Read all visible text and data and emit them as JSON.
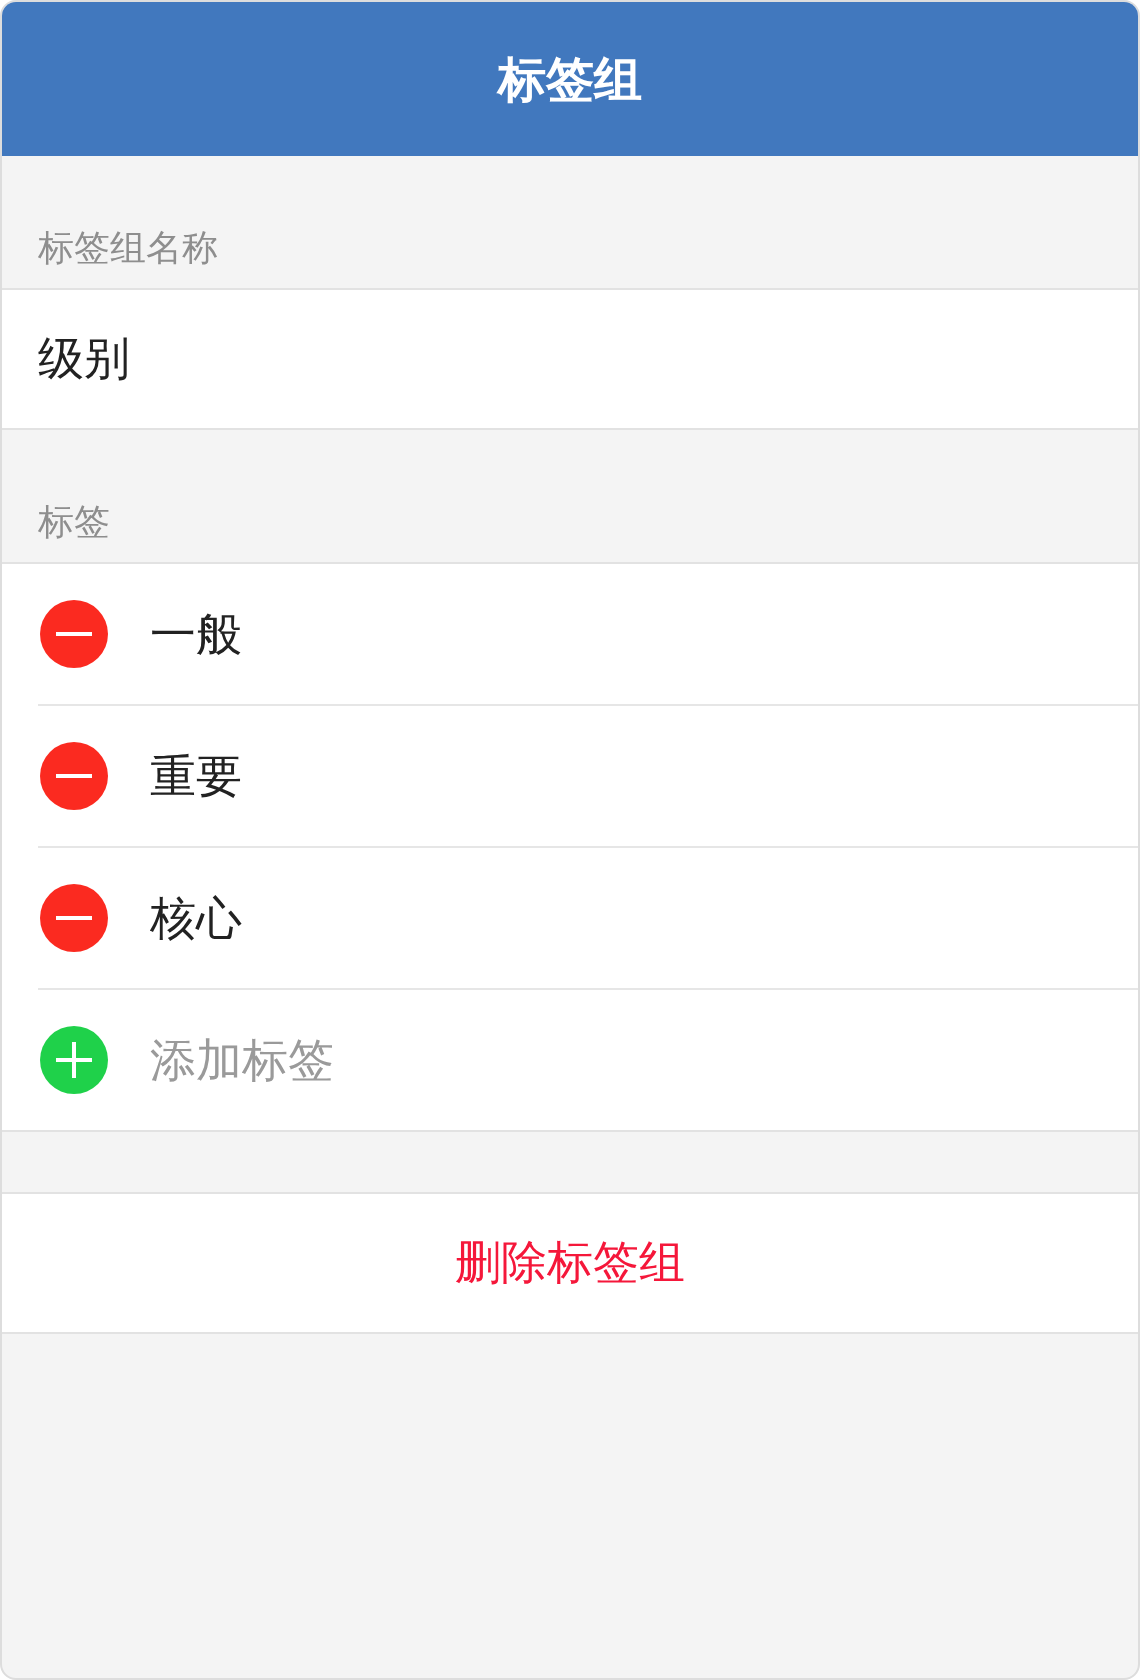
{
  "header": {
    "title": "标签组"
  },
  "name_section": {
    "label": "标签组名称",
    "value": "级别"
  },
  "tags_section": {
    "label": "标签",
    "items": [
      {
        "label": "一般",
        "kind": "remove"
      },
      {
        "label": "重要",
        "kind": "remove"
      },
      {
        "label": "核心",
        "kind": "remove"
      },
      {
        "label": "添加标签",
        "kind": "add"
      }
    ]
  },
  "delete_button": {
    "label": "删除标签组"
  }
}
